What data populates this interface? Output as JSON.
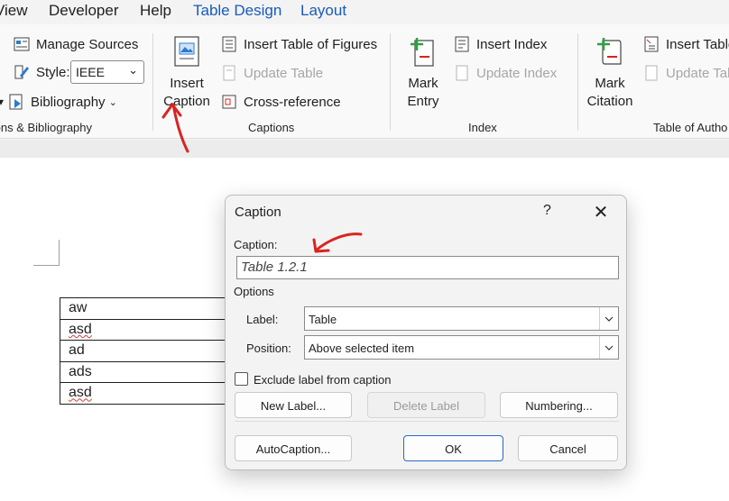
{
  "menubar": {
    "items": [
      {
        "label": "View",
        "x_hint": "left"
      },
      {
        "label": "Developer"
      },
      {
        "label": "Help"
      },
      {
        "label": "Table Design"
      },
      {
        "label": "Layout"
      }
    ]
  },
  "ribbon": {
    "citations_group": {
      "manage_sources": "Manage Sources",
      "style_label": "Style:",
      "style_value": "IEEE",
      "bibliography": "Bibliography",
      "group_label": "Citations & Bibliography"
    },
    "captions_group": {
      "insert_caption_line1": "Insert",
      "insert_caption_line2": "Caption",
      "insert_table_of_figures": "Insert Table of Figures",
      "update_table": "Update Table",
      "cross_reference": "Cross-reference",
      "group_label": "Captions"
    },
    "index_group": {
      "mark_entry_line1": "Mark",
      "mark_entry_line2": "Entry",
      "insert_index": "Insert Index",
      "update_index": "Update Index",
      "group_label": "Index"
    },
    "toa_group": {
      "mark_citation_line1": "Mark",
      "mark_citation_line2": "Citation",
      "insert_table": "Insert Table",
      "update_table": "Update Tab",
      "group_label": "Table of Autho"
    }
  },
  "document": {
    "table_rows": [
      "aw",
      "asd",
      "ad",
      "ads",
      "asd"
    ]
  },
  "dialog": {
    "title": "Caption",
    "help": "?",
    "close": "✕",
    "caption_label": "Caption:",
    "caption_value": "Table 1.2.1",
    "options_label": "Options",
    "label_label": "Label:",
    "label_value": "Table",
    "position_label": "Position:",
    "position_value": "Above selected item",
    "exclude_label": "Exclude label from caption",
    "new_label": "New Label...",
    "delete_label": "Delete Label",
    "numbering": "Numbering...",
    "autocaption": "AutoCaption...",
    "ok": "OK",
    "cancel": "Cancel"
  },
  "colors": {
    "accent": "#185abd",
    "annotation": "#d8241f"
  }
}
